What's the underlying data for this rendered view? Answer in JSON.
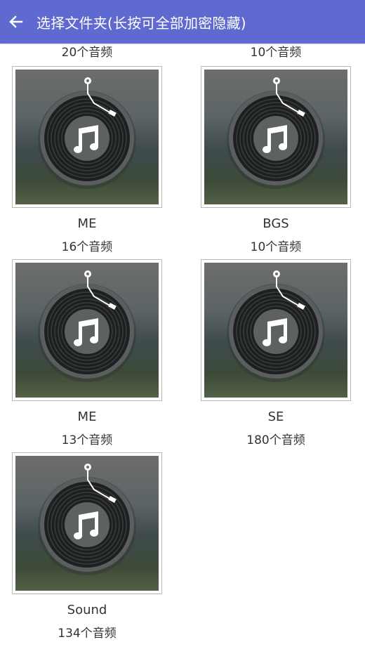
{
  "header": {
    "title": "选择文件夹(长按可全部加密隐藏)",
    "back_icon": "arrow-left-icon",
    "background": "#5f6ad1"
  },
  "partial_row": [
    {
      "count": "20个音频"
    },
    {
      "count": "10个音频"
    }
  ],
  "folders": [
    {
      "name": "ME",
      "count": "16个音频",
      "icon": "vinyl-record-icon"
    },
    {
      "name": "BGS",
      "count": "10个音频",
      "icon": "vinyl-record-icon"
    },
    {
      "name": "ME",
      "count": "13个音频",
      "icon": "vinyl-record-icon"
    },
    {
      "name": "SE",
      "count": "180个音频",
      "icon": "vinyl-record-icon"
    },
    {
      "name": "Sound",
      "count": "134个音频",
      "icon": "vinyl-record-icon"
    }
  ]
}
